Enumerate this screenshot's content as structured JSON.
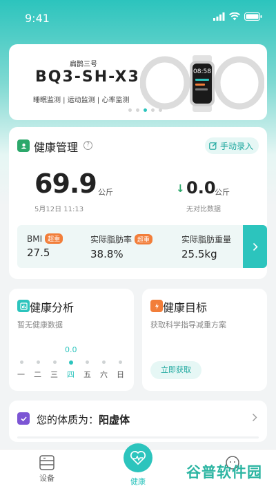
{
  "status_bar": {
    "time": "9:41"
  },
  "banner": {
    "subtitle": "扁鹊三号",
    "model": "BQ3-SH-X3",
    "features": "睡眠监测 | 运动监测 | 心率监测",
    "watch_time": "08:58",
    "carousel_count": 5,
    "carousel_active": 3
  },
  "health": {
    "title": "健康管理",
    "record_button": "手动录入",
    "weight": "69.9",
    "weight_unit": "公斤",
    "date": "5月12日 11:13",
    "change": "0.0",
    "change_unit": "公斤",
    "no_compare": "无对比数据",
    "metrics": [
      {
        "label": "BMI",
        "badge": "超重",
        "value": "27.5"
      },
      {
        "label": "实际脂肪率",
        "badge": "超重",
        "value": "38.8%"
      },
      {
        "label": "实际脂肪重量",
        "badge": "",
        "value": "25.5kg"
      }
    ]
  },
  "analysis": {
    "title": "健康分析",
    "empty": "暂无健康数据",
    "current_value": "0.0",
    "days": [
      "一",
      "二",
      "三",
      "四",
      "五",
      "六",
      "日"
    ],
    "active_day_index": 3
  },
  "goal": {
    "title": "健康目标",
    "desc": "获取科学指导减重方案",
    "button": "立即获取"
  },
  "constitution": {
    "label": "您的体质为：",
    "value": "阳虚体"
  },
  "tabbar": {
    "devices": "设备",
    "health": "健康"
  },
  "watermark": {
    "part1": "谷普",
    "part2": "软件园"
  },
  "colors": {
    "accent": "#2cc4bd",
    "badge": "#f27e3a",
    "down_arrow": "#2ca86b"
  }
}
